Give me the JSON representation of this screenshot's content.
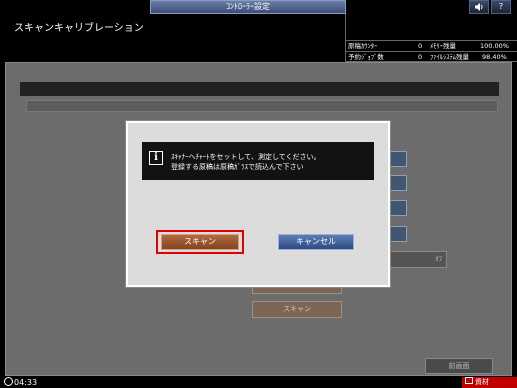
{
  "header": {
    "tab_title": "ｺﾝﾄﾛｰﾗｰ設定",
    "screen_title": "スキャンキャリブレーション",
    "volume_icon": "speaker-icon",
    "help_label": "?"
  },
  "status": {
    "original_count_label": "原稿ｶｳﾝﾀｰ",
    "original_count_value": "0",
    "memory_label": "ﾒﾓﾘｰ残量",
    "memory_value": "100.00%",
    "reserved_jobs_label": "予約ｼﾞｮﾌﾞ数",
    "reserved_jobs_value": "0",
    "filesystem_label": "ﾌｧｲﾙｼｽﾃﾑ残量",
    "filesystem_value": "98.40%"
  },
  "dialog": {
    "info_icon": "i",
    "message_line1": "ｽｷｬﾅｰへﾁｬｰﾄをセットして、測定してください。",
    "message_line2": "登録する原稿は原稿ｶﾞﾗｽで読込んで下さい",
    "scan_button": "スキャン",
    "cancel_button": "キャンセル"
  },
  "background": {
    "off_label": "ｵﾌ",
    "chart_print_button": "チャート印刷",
    "scan_button": "スキャン",
    "prev_screen_button": "前画面"
  },
  "footer": {
    "time": "04:33",
    "supplies_label": "資材"
  },
  "colors": {
    "scan_highlight": "#e00000",
    "supplies_bg": "#c00000"
  }
}
